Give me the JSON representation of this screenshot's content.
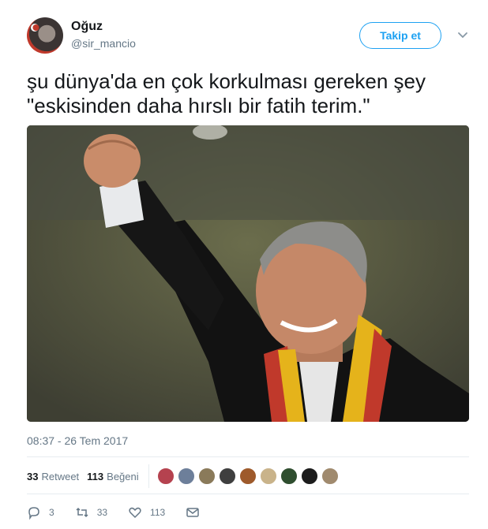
{
  "user": {
    "name": "Oğuz",
    "handle": "@sir_mancio"
  },
  "follow_label": "Takip et",
  "tweet": {
    "text": "şu dünya'da en çok korkulması gereken şey\n\"eskisinden daha hırslı bir fatih terim.\""
  },
  "timestamp": "08:37 - 26 Tem 2017",
  "stats": {
    "retweets": "33",
    "retweets_label": "Retweet",
    "likes": "113",
    "likes_label": "Beğeni"
  },
  "liker_colors": [
    "#b5424f",
    "#6d7f9a",
    "#8a7a5a",
    "#3f3f3f",
    "#9e5a2b",
    "#c9b38a",
    "#2f4e2f",
    "#1c1c1c",
    "#a08a6e"
  ],
  "actions": {
    "reply_count": "3",
    "retweet_count": "33",
    "like_count": "113"
  },
  "colors": {
    "accent": "#1da1f2",
    "secondary_text": "#657786"
  },
  "icons": [
    "chevron-down-icon",
    "reply-icon",
    "retweet-icon",
    "heart-icon",
    "message-icon"
  ]
}
